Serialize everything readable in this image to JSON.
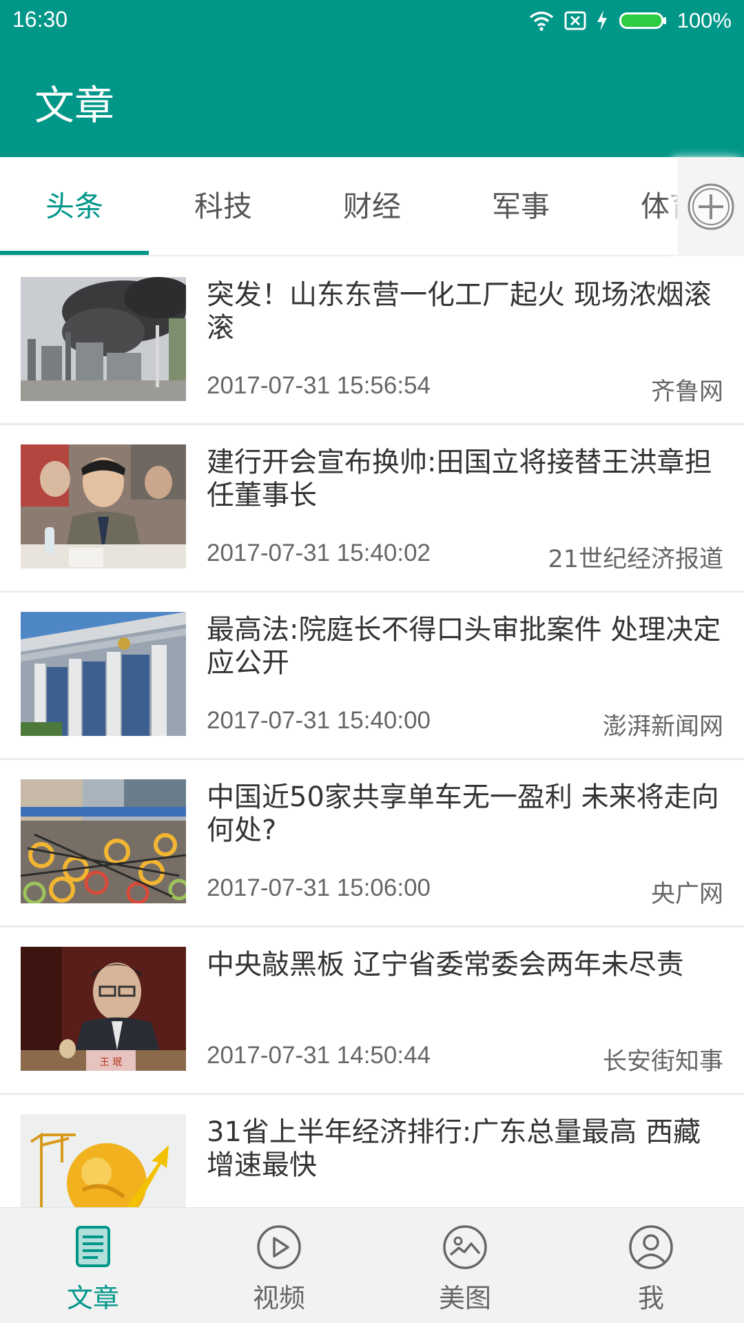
{
  "status_bar": {
    "time": "16:30",
    "battery": "100%"
  },
  "app_bar": {
    "title": "文章"
  },
  "colors": {
    "primary": "#009688",
    "battery": "#2ecc40"
  },
  "tabs": [
    {
      "label": "头条",
      "active": true
    },
    {
      "label": "科技"
    },
    {
      "label": "财经"
    },
    {
      "label": "军事"
    },
    {
      "label": "体育"
    }
  ],
  "articles": [
    {
      "title": "突发！山东东营一化工厂起火 现场浓烟滚滚",
      "time": "2017-07-31 15:56:54",
      "source": "齐鲁网"
    },
    {
      "title": "建行开会宣布换帅:田国立将接替王洪章担任董事长",
      "time": "2017-07-31 15:40:02",
      "source": "21世纪经济报道"
    },
    {
      "title": "最高法:院庭长不得口头审批案件 处理决定应公开",
      "time": "2017-07-31 15:40:00",
      "source": "澎湃新闻网"
    },
    {
      "title": "中国近50家共享单车无一盈利 未来将走向何处?",
      "time": "2017-07-31 15:06:00",
      "source": "央广网"
    },
    {
      "title": "中央敲黑板 辽宁省委常委会两年未尽责",
      "time": "2017-07-31 14:50:44",
      "source": "长安街知事",
      "nameplate": "王 珉"
    },
    {
      "title": "31省上半年经济排行:广东总量最高 西藏增速最快",
      "time": "",
      "source": ""
    }
  ],
  "bottom_nav": [
    {
      "label": "文章",
      "icon": "article-icon",
      "active": true
    },
    {
      "label": "视频",
      "icon": "video-play-icon"
    },
    {
      "label": "美图",
      "icon": "picture-icon"
    },
    {
      "label": "我",
      "icon": "user-icon"
    }
  ]
}
